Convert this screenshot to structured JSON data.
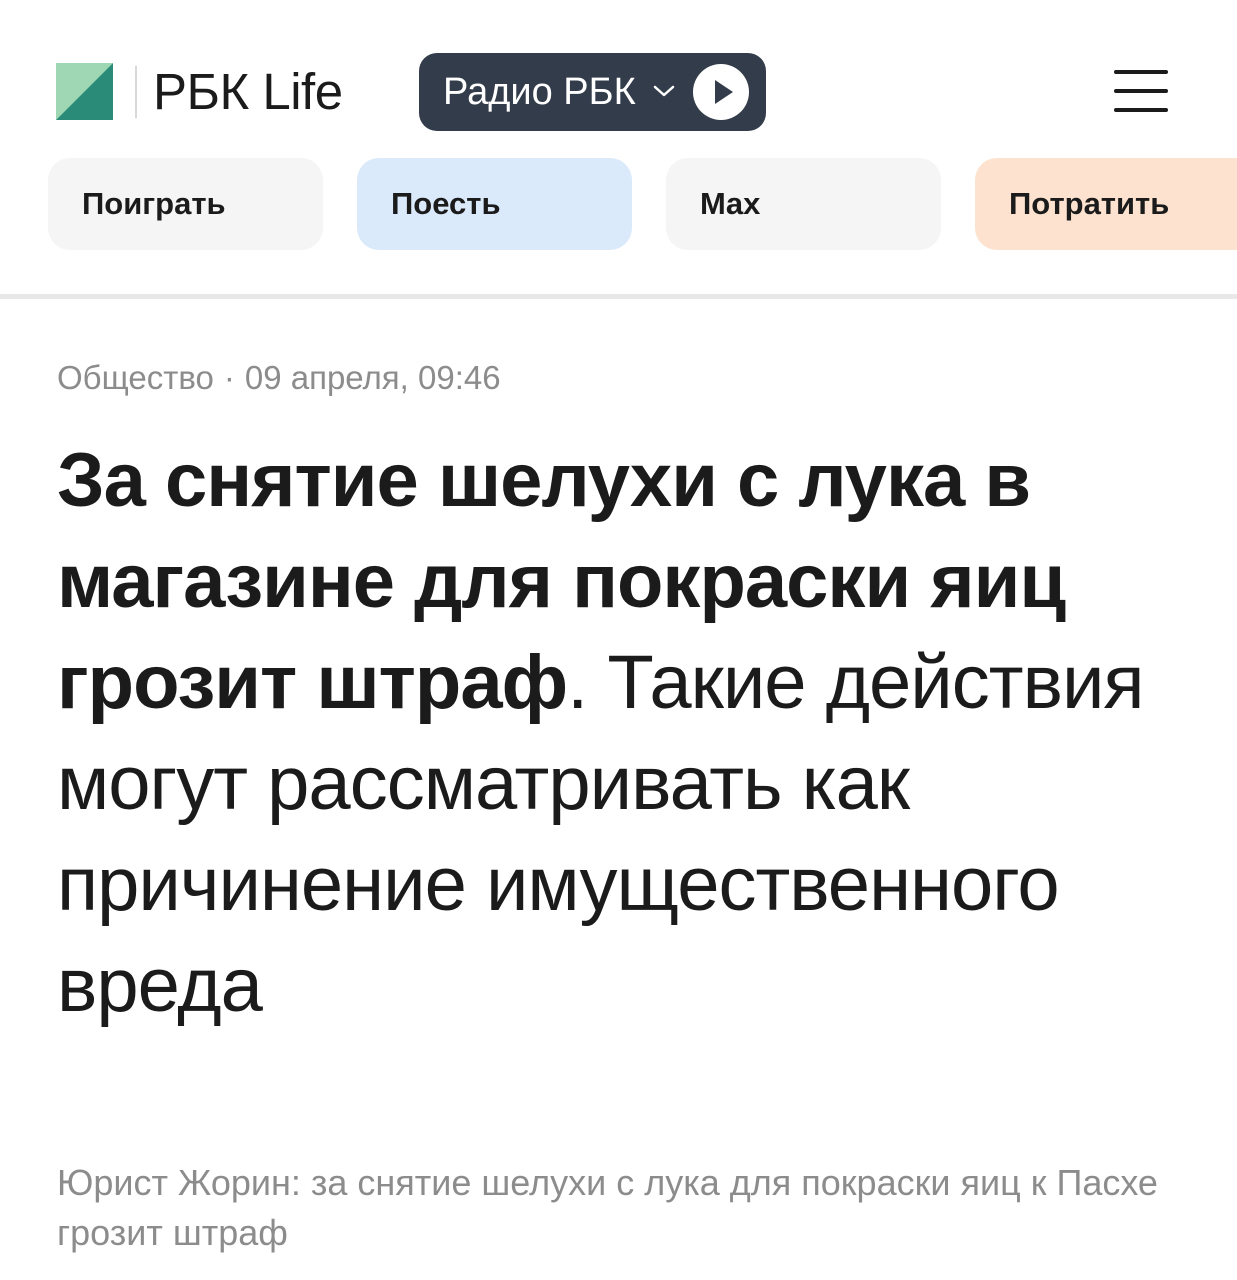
{
  "header": {
    "brand": "РБК Life",
    "radio_label": "Радио РБК",
    "logo_colors": {
      "light": "#9fd6b3",
      "dark": "#2a8c78"
    }
  },
  "chips": [
    {
      "label": "Поиграть",
      "bg": "#f5f5f5"
    },
    {
      "label": "Поесть",
      "bg": "#dbeafb"
    },
    {
      "label": "Max",
      "bg": "#f5f5f5"
    },
    {
      "label": "Потратить",
      "bg": "#fde3cf"
    }
  ],
  "article": {
    "category": "Общество",
    "separator": "·",
    "datetime": "09 апреля, 09:46",
    "headline_bold": "За снятие шелухи с лука в магазине для покраски яиц грозит штраф",
    "headline_rest": ". Такие действия могут рассматривать как причинение имущественного вреда",
    "subtitle": "Юрист Жорин: за снятие шелухи с лука для покраски яиц к Пасхе грозит штраф"
  },
  "icons": {
    "menu": "hamburger-icon",
    "radio_chevron": "chevron-down-icon",
    "radio_play": "play-icon",
    "logo": "rbc-logo"
  }
}
